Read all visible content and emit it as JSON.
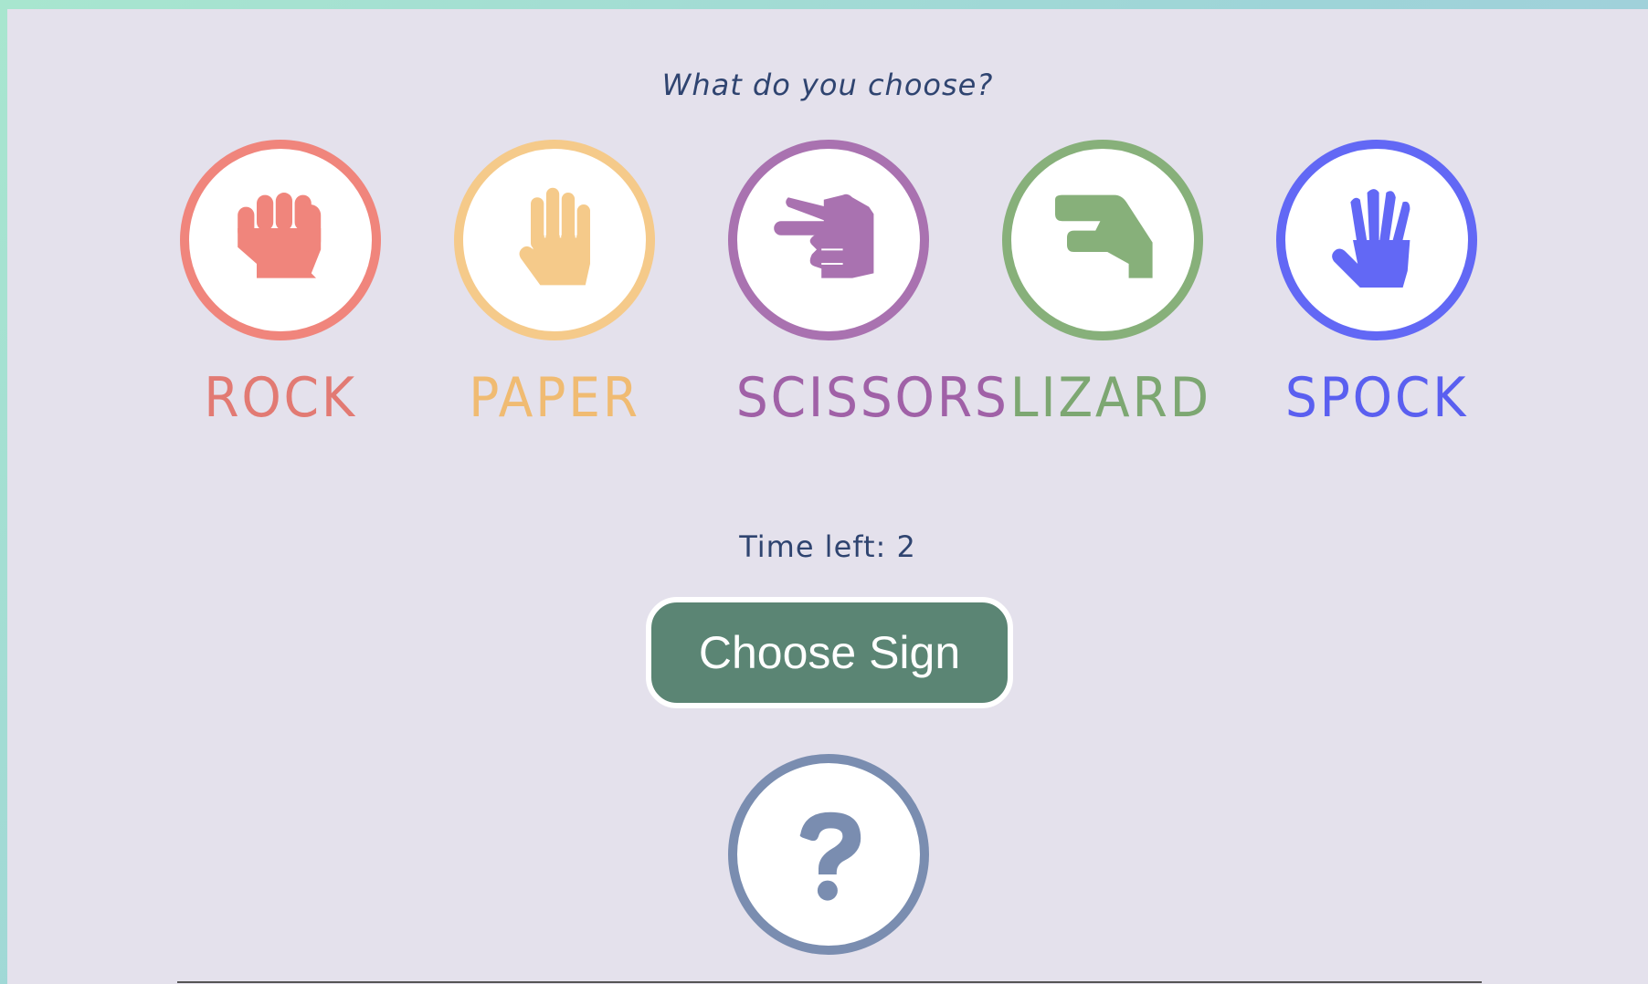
{
  "prompt": "What do you choose?",
  "choices": [
    {
      "id": "rock",
      "label": "ROCK",
      "color": "#f0857c",
      "icon": "fist-icon"
    },
    {
      "id": "paper",
      "label": "PAPER",
      "color": "#f5ca8a",
      "icon": "open-hand-icon"
    },
    {
      "id": "scissors",
      "label": "SCISSORS",
      "color": "#a972b0",
      "icon": "scissors-hand-icon"
    },
    {
      "id": "lizard",
      "label": "LIZARD",
      "color": "#87b07a",
      "icon": "lizard-hand-icon"
    },
    {
      "id": "spock",
      "label": "SPOCK",
      "color": "#6268f5",
      "icon": "spock-hand-icon"
    }
  ],
  "timer": "Time left: 2",
  "choose_button": "Choose Sign",
  "mystery": {
    "icon": "question-mark-icon",
    "color": "#7a8db0"
  },
  "colors": {
    "background": "#e4e1ec",
    "text": "#2f4470",
    "button": "#5b8574"
  }
}
